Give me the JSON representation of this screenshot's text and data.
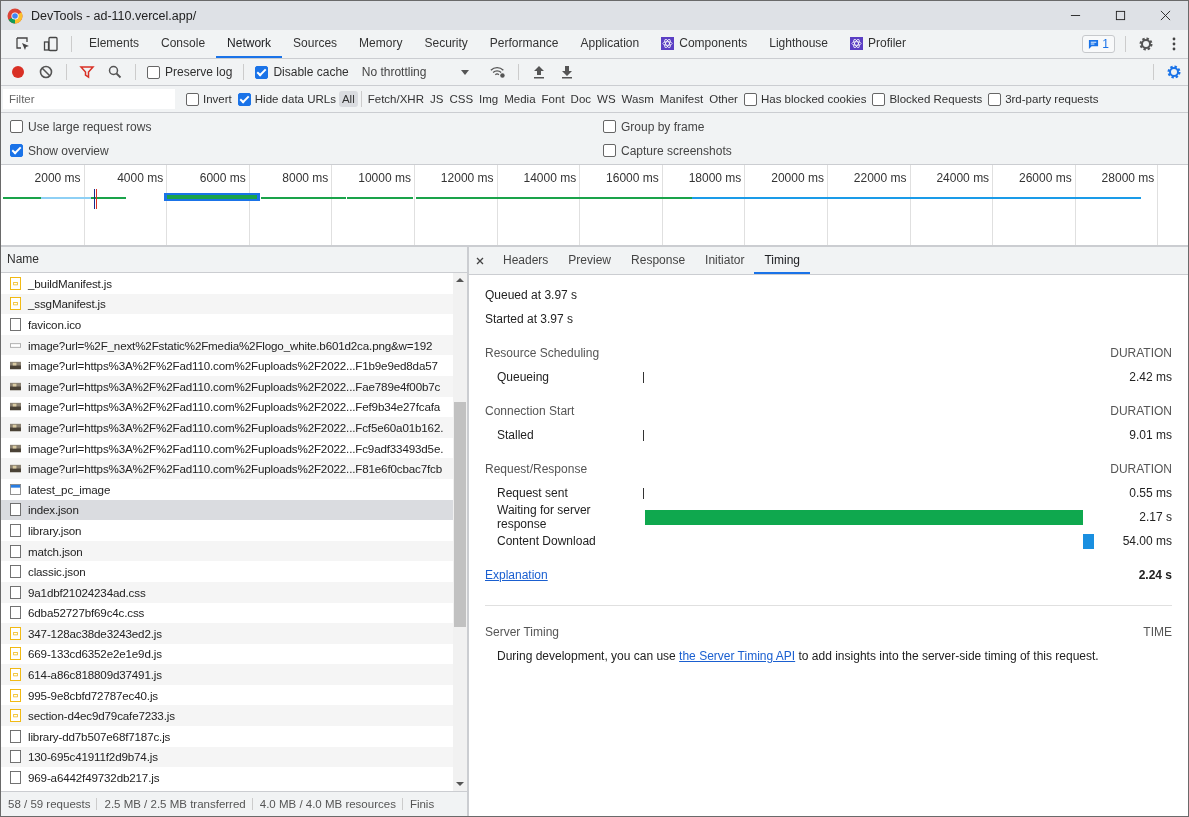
{
  "window": {
    "title": "DevTools - ad-110.vercel.app/"
  },
  "panel_tabs": [
    {
      "label": "Elements",
      "selected": false,
      "kind": "plain"
    },
    {
      "label": "Console",
      "selected": false,
      "kind": "plain"
    },
    {
      "label": "Network",
      "selected": true,
      "kind": "plain"
    },
    {
      "label": "Sources",
      "selected": false,
      "kind": "plain"
    },
    {
      "label": "Memory",
      "selected": false,
      "kind": "plain"
    },
    {
      "label": "Security",
      "selected": false,
      "kind": "plain"
    },
    {
      "label": "Performance",
      "selected": false,
      "kind": "plain"
    },
    {
      "label": "Application",
      "selected": false,
      "kind": "plain"
    },
    {
      "label": "Components",
      "selected": false,
      "kind": "react"
    },
    {
      "label": "Lighthouse",
      "selected": false,
      "kind": "plain"
    },
    {
      "label": "Profiler",
      "selected": false,
      "kind": "react"
    }
  ],
  "issues_badge": "1",
  "toolbar": {
    "preserve_log": {
      "label": "Preserve log",
      "checked": false
    },
    "disable_cache": {
      "label": "Disable cache",
      "checked": true
    },
    "throttling": "No throttling"
  },
  "filter": {
    "placeholder": "Filter",
    "invert": {
      "label": "Invert",
      "checked": false
    },
    "hide_data_urls": {
      "label": "Hide data URLs",
      "checked": true
    },
    "types": [
      {
        "label": "All",
        "selected": true
      },
      {
        "label": "Fetch/XHR",
        "selected": false
      },
      {
        "label": "JS",
        "selected": false
      },
      {
        "label": "CSS",
        "selected": false
      },
      {
        "label": "Img",
        "selected": false
      },
      {
        "label": "Media",
        "selected": false
      },
      {
        "label": "Font",
        "selected": false
      },
      {
        "label": "Doc",
        "selected": false
      },
      {
        "label": "WS",
        "selected": false
      },
      {
        "label": "Wasm",
        "selected": false
      },
      {
        "label": "Manifest",
        "selected": false
      },
      {
        "label": "Other",
        "selected": false
      }
    ],
    "extra": [
      {
        "label": "Has blocked cookies",
        "checked": false
      },
      {
        "label": "Blocked Requests",
        "checked": false
      },
      {
        "label": "3rd-party requests",
        "checked": false
      }
    ]
  },
  "options": [
    {
      "label": "Use large request rows",
      "checked": false
    },
    {
      "label": "Group by frame",
      "checked": false
    },
    {
      "label": "Show overview",
      "checked": true
    },
    {
      "label": "Capture screenshots",
      "checked": false
    }
  ],
  "overview": {
    "ticks": [
      "2000 ms",
      "4000 ms",
      "6000 ms",
      "8000 ms",
      "10000 ms",
      "12000 ms",
      "14000 ms",
      "16000 ms",
      "18000 ms",
      "20000 ms",
      "22000 ms",
      "24000 ms",
      "26000 ms",
      "28000 ms"
    ]
  },
  "requests": {
    "column": "Name",
    "rows": [
      {
        "name": "_buildManifest.js",
        "kind": "script",
        "selected": false
      },
      {
        "name": "_ssgManifest.js",
        "kind": "script",
        "selected": false
      },
      {
        "name": "favicon.ico",
        "kind": "document",
        "selected": false
      },
      {
        "name": "image?url=%2F_next%2Fstatic%2Fmedia%2Flogo_white.b601d2ca.png&w=192",
        "kind": "blank",
        "selected": false
      },
      {
        "name": "image?url=https%3A%2F%2Fad110.com%2Fuploads%2F2022...F1b9e9ed8da57",
        "kind": "image",
        "selected": false
      },
      {
        "name": "image?url=https%3A%2F%2Fad110.com%2Fuploads%2F2022...Fae789e4f00b7c",
        "kind": "image",
        "selected": false
      },
      {
        "name": "image?url=https%3A%2F%2Fad110.com%2Fuploads%2F2022...Fef9b34e27fcafa",
        "kind": "image",
        "selected": false
      },
      {
        "name": "image?url=https%3A%2F%2Fad110.com%2Fuploads%2F2022...Fcf5e60a01b162.",
        "kind": "image",
        "selected": false
      },
      {
        "name": "image?url=https%3A%2F%2Fad110.com%2Fuploads%2F2022...Fc9adf33493d5e.",
        "kind": "image",
        "selected": false
      },
      {
        "name": "image?url=https%3A%2F%2Fad110.com%2Fuploads%2F2022...F81e6f0cbac7fcb",
        "kind": "image",
        "selected": false
      },
      {
        "name": "latest_pc_image",
        "kind": "window",
        "selected": false
      },
      {
        "name": "index.json",
        "kind": "document",
        "selected": true
      },
      {
        "name": "library.json",
        "kind": "document",
        "selected": false
      },
      {
        "name": "match.json",
        "kind": "document",
        "selected": false
      },
      {
        "name": "classic.json",
        "kind": "document",
        "selected": false
      },
      {
        "name": "9a1dbf21024234ad.css",
        "kind": "document",
        "selected": false
      },
      {
        "name": "6dba52727bf69c4c.css",
        "kind": "document",
        "selected": false
      },
      {
        "name": "347-128ac38de3243ed2.js",
        "kind": "script",
        "selected": false
      },
      {
        "name": "669-133cd6352e2e1e9d.js",
        "kind": "script",
        "selected": false
      },
      {
        "name": "614-a86c818809d37491.js",
        "kind": "script",
        "selected": false
      },
      {
        "name": "995-9e8cbfd72787ec40.js",
        "kind": "script",
        "selected": false
      },
      {
        "name": "section-d4ec9d79cafe7233.js",
        "kind": "script",
        "selected": false
      },
      {
        "name": "library-dd7b507e68f7187c.js",
        "kind": "document",
        "selected": false
      },
      {
        "name": "130-695c41911f2d9b74.js",
        "kind": "document",
        "selected": false
      },
      {
        "name": "969-a6442f49732db217.js",
        "kind": "document",
        "selected": false
      }
    ]
  },
  "status_bar": [
    "58 / 59 requests",
    "2.5 MB / 2.5 MB transferred",
    "4.0 MB / 4.0 MB resources",
    "Finis"
  ],
  "detail_tabs": [
    {
      "label": "Headers",
      "selected": false
    },
    {
      "label": "Preview",
      "selected": false
    },
    {
      "label": "Response",
      "selected": false
    },
    {
      "label": "Initiator",
      "selected": false
    },
    {
      "label": "Timing",
      "selected": true
    }
  ],
  "timing": {
    "queued": "Queued at 3.97 s",
    "started": "Started at 3.97 s",
    "sections": [
      {
        "title": "Resource Scheduling",
        "header": "DURATION",
        "phases": [
          {
            "label": "Queueing",
            "kind": "line",
            "value": "2.42 ms"
          }
        ]
      },
      {
        "title": "Connection Start",
        "header": "DURATION",
        "phases": [
          {
            "label": "Stalled",
            "kind": "line",
            "value": "9.01 ms"
          }
        ]
      },
      {
        "title": "Request/Response",
        "header": "DURATION",
        "phases": [
          {
            "label": "Request sent",
            "kind": "line",
            "value": "0.55 ms"
          },
          {
            "label": "Waiting for server response",
            "kind": "waiting",
            "value": "2.17 s"
          },
          {
            "label": "Content Download",
            "kind": "download",
            "value": "54.00 ms"
          }
        ]
      }
    ],
    "explanation": "Explanation",
    "total": "2.24 s",
    "server_timing": {
      "title": "Server Timing",
      "header": "TIME",
      "before": "During development, you can use ",
      "link": "the Server Timing API",
      "after": " to add insights into the server-side timing of this request."
    }
  }
}
